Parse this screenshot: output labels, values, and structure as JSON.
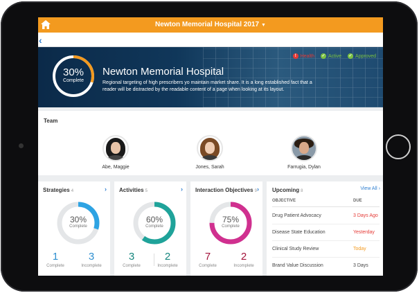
{
  "app": {
    "title": "Newton Memorial Hospital 2017",
    "accent_color": "#f39a1f"
  },
  "hero": {
    "progress_percent": 30,
    "progress_label": "30%",
    "progress_caption": "Complete",
    "name": "Newton Memorial Hospital",
    "description": "Regional targeting of high prescribers yo maintain market share. It is a long established fact that a reader will be distracted by the readable content of a page when looking at its layout.",
    "statuses": [
      {
        "label": "Health",
        "icon": "alert-icon",
        "color": "#e53935"
      },
      {
        "label": "Active",
        "icon": "check-circle-icon",
        "color": "#7cc242"
      },
      {
        "label": "Approved",
        "icon": "check-circle-icon",
        "color": "#7cc242"
      }
    ]
  },
  "team": {
    "title": "Team",
    "members": [
      {
        "name": "Abe, Maggie"
      },
      {
        "name": "Jones, Sarah"
      },
      {
        "name": "Farrugia, Dylan"
      }
    ]
  },
  "cards": [
    {
      "title": "Strategies",
      "count": "4",
      "percent": 30,
      "percent_label": "30%",
      "caption": "Complete",
      "complete": "1",
      "complete_label": "Complete",
      "incomplete": "3",
      "incomplete_label": "Incomplete",
      "color": "#2ea3e3",
      "num_color": "#2e8fd0"
    },
    {
      "title": "Activities",
      "count": "5",
      "percent": 60,
      "percent_label": "60%",
      "caption": "Complete",
      "complete": "3",
      "complete_label": "Complete",
      "incomplete": "2",
      "incomplete_label": "Incomplete",
      "color": "#1fa39a",
      "num_color": "#14857d"
    },
    {
      "title": "Interaction Objectives",
      "count": "9",
      "percent": 75,
      "percent_label": "75%",
      "caption": "Complete",
      "complete": "7",
      "complete_label": "Complete",
      "incomplete": "2",
      "incomplete_label": "Incomplete",
      "color": "#d0308f",
      "num_color": "#a3123a"
    }
  ],
  "upcoming": {
    "title": "Upcoming",
    "count": "8",
    "view_all": "View All",
    "col_objective": "OBJECTIVE",
    "col_due": "DUE",
    "rows": [
      {
        "objective": "Drug Patient Advocacy",
        "due": "3 Days Ago",
        "color": "#e53935"
      },
      {
        "objective": "Disease State Education",
        "due": "Yesterday",
        "color": "#e53935"
      },
      {
        "objective": "Clinical Study Review",
        "due": "Today",
        "color": "#f39a1f"
      },
      {
        "objective": "Brand Value Discussion",
        "due": "3 Days",
        "color": "#444444"
      }
    ]
  }
}
